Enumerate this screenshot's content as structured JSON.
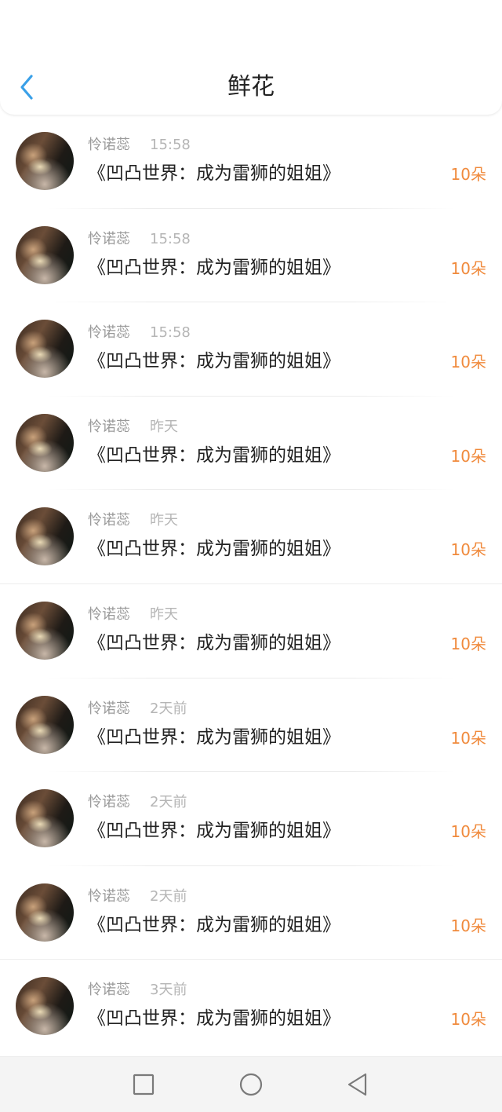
{
  "header": {
    "title": "鲜花",
    "back_icon": "chevron-left-icon",
    "accent": "#3aa0e8"
  },
  "list": [
    {
      "user": "怜诺蕊",
      "time": "15:58",
      "book": "《凹凸世界：成为雷狮的姐姐》",
      "count": "10朵"
    },
    {
      "user": "怜诺蕊",
      "time": "15:58",
      "book": "《凹凸世界：成为雷狮的姐姐》",
      "count": "10朵"
    },
    {
      "user": "怜诺蕊",
      "time": "15:58",
      "book": "《凹凸世界：成为雷狮的姐姐》",
      "count": "10朵"
    },
    {
      "user": "怜诺蕊",
      "time": "昨天",
      "book": "《凹凸世界：成为雷狮的姐姐》",
      "count": "10朵"
    },
    {
      "user": "怜诺蕊",
      "time": "昨天",
      "book": "《凹凸世界：成为雷狮的姐姐》",
      "count": "10朵"
    },
    {
      "user": "怜诺蕊",
      "time": "昨天",
      "book": "《凹凸世界：成为雷狮的姐姐》",
      "count": "10朵"
    },
    {
      "user": "怜诺蕊",
      "time": "2天前",
      "book": "《凹凸世界：成为雷狮的姐姐》",
      "count": "10朵"
    },
    {
      "user": "怜诺蕊",
      "time": "2天前",
      "book": "《凹凸世界：成为雷狮的姐姐》",
      "count": "10朵"
    },
    {
      "user": "怜诺蕊",
      "time": "2天前",
      "book": "《凹凸世界：成为雷狮的姐姐》",
      "count": "10朵"
    },
    {
      "user": "怜诺蕊",
      "time": "3天前",
      "book": "《凹凸世界：成为雷狮的姐姐》",
      "count": "10朵"
    }
  ],
  "navbar": {
    "icons": [
      "recent-apps-icon",
      "home-icon",
      "back-triangle-icon"
    ]
  },
  "colors": {
    "count": "#f08a3c",
    "name": "#9a9a9a",
    "time": "#b5b5b5"
  }
}
